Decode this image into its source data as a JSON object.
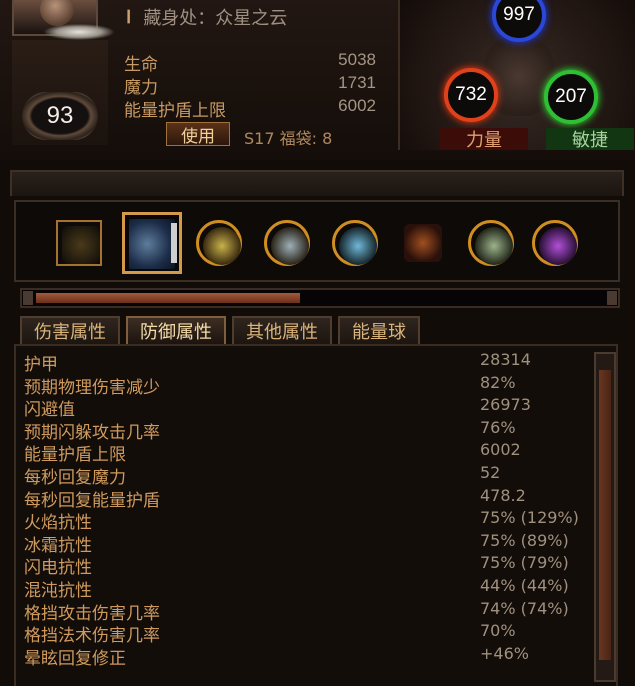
{
  "character": {
    "level": "93",
    "hideout_roman": "Ⅰ",
    "hideout": "藏身处：众星之云"
  },
  "stats": [
    {
      "label": "生命",
      "value": "5038"
    },
    {
      "label": "魔力",
      "value": "1731"
    },
    {
      "label": "能量护盾上限",
      "value": "6002"
    }
  ],
  "use_button": "使用",
  "season_text": "S17 福袋: 8",
  "attributes": {
    "intelligence": "997",
    "strength": "732",
    "dexterity": "207",
    "strength_label": "力量",
    "dexterity_label": "敏捷"
  },
  "skill_scroll_progress": 0.44,
  "tabs": [
    "伤害属性",
    "防御属性",
    "其他属性",
    "能量球"
  ],
  "active_tab": 1,
  "defense_stats": [
    {
      "label": "护甲",
      "value": "28314"
    },
    {
      "label": "预期物理伤害减少",
      "value": "82%"
    },
    {
      "label": "闪避值",
      "value": "26973"
    },
    {
      "label": "预期闪躲攻击几率",
      "value": "76%"
    },
    {
      "label": "能量护盾上限",
      "value": "6002"
    },
    {
      "label": "每秒回复魔力",
      "value": "52"
    },
    {
      "label": "每秒回复能量护盾",
      "value": "478.2"
    },
    {
      "label": "火焰抗性",
      "value": "75% (129%)"
    },
    {
      "label": "冰霜抗性",
      "value": "75% (89%)"
    },
    {
      "label": "闪电抗性",
      "value": "75% (79%)"
    },
    {
      "label": "混沌抗性",
      "value": "44% (44%)"
    },
    {
      "label": "格挡攻击伤害几率",
      "value": "74% (74%)"
    },
    {
      "label": "格挡法术伤害几率",
      "value": "70%"
    },
    {
      "label": "晕眩回复修正",
      "value": "+46%"
    }
  ],
  "colors": {
    "intelligence": "#2b47d6",
    "strength": "#e0401a",
    "dexterity": "#2fbf35",
    "stat_label": "#cf9a5e",
    "tab_active_border": "#7f5f3c"
  },
  "skill_icons": [
    "sword-icon",
    "skill-icon-blue",
    "lightning-ring-icon",
    "spectral-ring-icon",
    "ice-ring-icon",
    "fire-skill-icon",
    "nature-ring-icon",
    "purple-lightning-icon"
  ]
}
